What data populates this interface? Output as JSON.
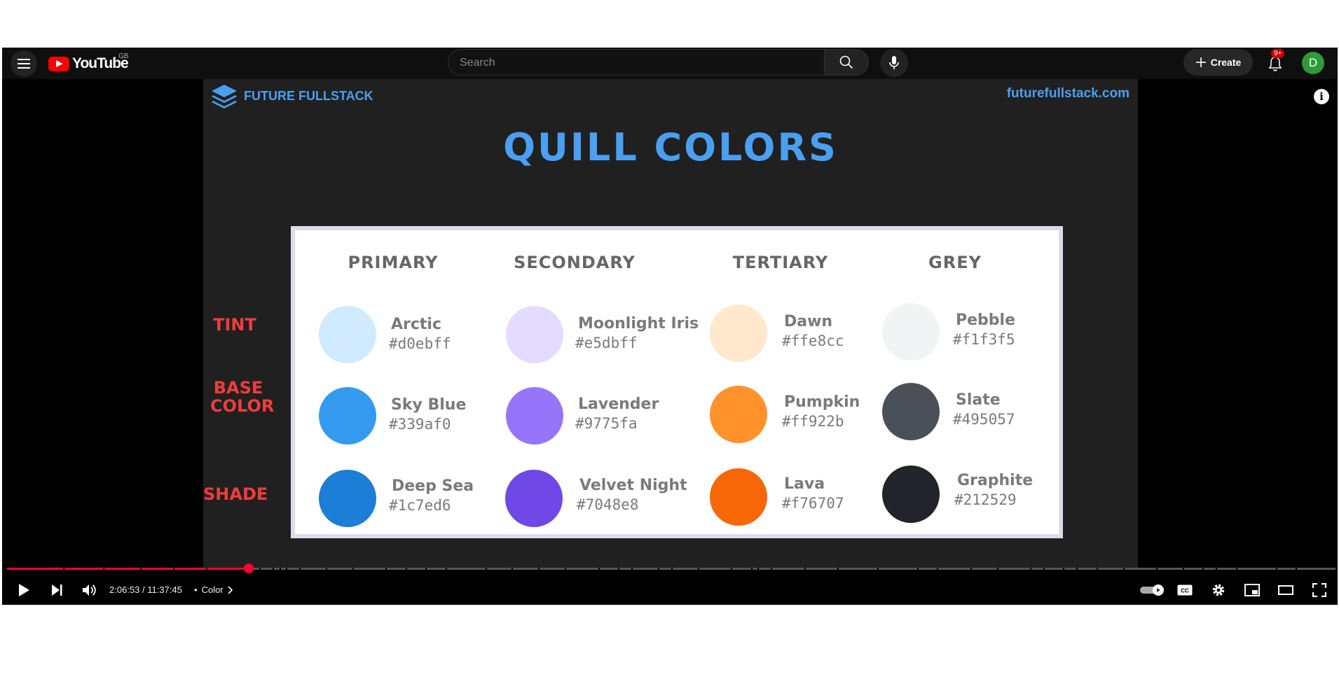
{
  "header": {
    "logo_text": "YouTube",
    "region": "GB",
    "search_placeholder": "Search",
    "create_label": "Create",
    "notifications_badge": "9+",
    "avatar_initial": "D"
  },
  "video_frame": {
    "brand": "FUTURE FULLSTACK",
    "site": "futurefullstack.com",
    "title": "QUILL COLORS",
    "row_labels": [
      "TINT",
      "BASE COLOR",
      "SHADE"
    ],
    "columns": [
      {
        "heading": "PRIMARY",
        "swatches": [
          {
            "name": "Arctic",
            "hex": "#d0ebff",
            "color": "#d0ebff"
          },
          {
            "name": "Sky Blue",
            "hex": "#339af0",
            "color": "#339af0"
          },
          {
            "name": "Deep Sea",
            "hex": "#1c7ed6",
            "color": "#1c7ed6"
          }
        ]
      },
      {
        "heading": "SECONDARY",
        "swatches": [
          {
            "name": "Moonlight Iris",
            "hex": "#e5dbff",
            "color": "#e5dbff"
          },
          {
            "name": "Lavender",
            "hex": "#9775fa",
            "color": "#9775fa"
          },
          {
            "name": "Velvet Night",
            "hex": "#7048e8",
            "color": "#7048e8"
          }
        ]
      },
      {
        "heading": "TERTIARY",
        "swatches": [
          {
            "name": "Dawn",
            "hex": "#ffe8cc",
            "color": "#ffe8cc"
          },
          {
            "name": "Pumpkin",
            "hex": "#ff922b",
            "color": "#ff922b"
          },
          {
            "name": "Lava",
            "hex": "#f76707",
            "color": "#f76707"
          }
        ]
      },
      {
        "heading": "GREY",
        "swatches": [
          {
            "name": "Pebble",
            "hex": "#f1f3f5",
            "color": "#f1f3f5"
          },
          {
            "name": "Slate",
            "hex": "#495057",
            "color": "#495057"
          },
          {
            "name": "Graphite",
            "hex": "#212529",
            "color": "#212529"
          }
        ]
      }
    ]
  },
  "player": {
    "current_time": "2:06:53",
    "duration": "11:37:45",
    "time_display": "2:06:53 / 11:37:45",
    "chapter_separator": "•",
    "chapter": "Color",
    "progress_fraction": 0.1818,
    "accent_color": "#ff0033"
  }
}
